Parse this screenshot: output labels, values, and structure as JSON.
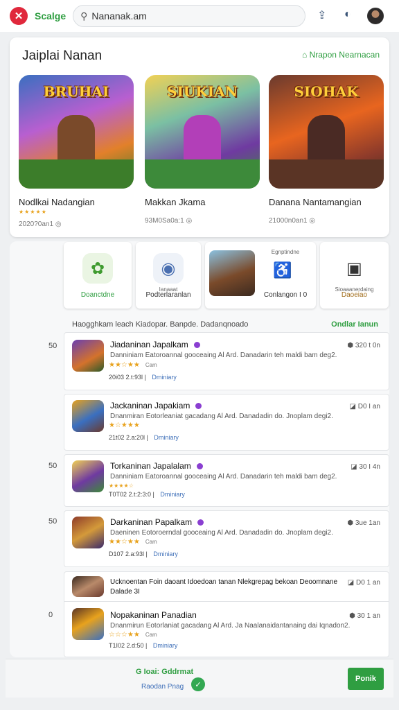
{
  "header": {
    "brand": "Scalge",
    "search_value": "Nananak.am"
  },
  "featured": {
    "title": "Jaiplai Nanan",
    "more_label": "Nrapon Nearnacan",
    "games": [
      {
        "art_title": "BRUHAI",
        "name": "Nodlkai Nadangian",
        "meta": "2020?0an1",
        "colors": [
          "#3a8fd0",
          "#d4722c",
          "#3e7d2c"
        ]
      },
      {
        "art_title": "SIUKIAN",
        "name": "Makkan Jkama",
        "meta": "93M0Sa0a:1",
        "colors": [
          "#f0c247",
          "#9b3fb6",
          "#3d8a3a"
        ]
      },
      {
        "art_title": "SIOHAK",
        "name": "Danana Nantamangian",
        "meta": "21000n0an1",
        "colors": [
          "#e8651f",
          "#8e3b2a",
          "#5a3425"
        ]
      }
    ]
  },
  "categories": [
    {
      "label": "Doanctdne",
      "sub": "",
      "icon": "✿",
      "icon_color": "#3f9b2f",
      "icon_bg": "#eaf5e3"
    },
    {
      "label": "Podterlaranlan",
      "sub": "Ianaaat",
      "icon": "◉",
      "icon_color": "#4a6fb0",
      "icon_bg": "#eef2f8"
    },
    {
      "label": "Conlangon I 0",
      "sub": "Egnptindne",
      "icon": "♿",
      "icon_color": "#333",
      "icon_bg": "#ffffff"
    },
    {
      "label": "Daoeiao",
      "sub": "Sioaaanerdaing",
      "icon": "▣",
      "icon_color": "#333",
      "icon_bg": "#ffffff"
    }
  ],
  "list_header": {
    "left": "Haogghkam leach Kiadopar. Banpde. Dadanqnoado",
    "right": "Ondlar Ianun"
  },
  "side_numbers": [
    "50",
    "50",
    "50",
    "0"
  ],
  "apps": [
    {
      "title": "Jiadaninan Japalkam",
      "desc": "Danniniam Eatoroannal gooceaing Al Ard. Danadarin teh maldi bam deg2.",
      "stars": "★★☆★★",
      "rating": "Cam",
      "date": "20i03 2.t:93l",
      "tag": "Dminiary",
      "size": "320 t 0n"
    },
    {
      "title": "Jackaninan Japakiam",
      "desc": "Dnanmiran Eotorleaniat gacadang Al Ard. Danadadin do. Jnoplam degi2.",
      "stars": "★☆★★★",
      "rating": "",
      "date": "21t02 2.a:20l",
      "tag": "Dminiary",
      "size": "D0 I an"
    },
    {
      "title": "Torkaninan Japalalam",
      "desc": "Danniniam Eatoroannal gooceaing Al Ard. Danadarin teh maldi bam deg2.",
      "stars": "★★★★☆",
      "rating": "",
      "date": "T0T02 2.t:2:3:0",
      "tag": "Dminiary",
      "size": "30 I 4n"
    },
    {
      "title": "Darkaninan Papalkam",
      "desc": "Daeninen Eotoroerndal gooceaing Al Ard. Danadadin do. Jnoplam degi2.",
      "stars": "★★☆★★",
      "rating": "Cam",
      "date": "D107 2.a:93l",
      "tag": "Dminiary",
      "size": "3ue 1an"
    },
    {
      "title": "Ucknoentan Foin daoant Idoedoan tanan Nlekgrepag bekoan Deoomnane Dalade 3I",
      "desc": "",
      "stars": "",
      "rating": "",
      "date": "",
      "tag": "",
      "size": "D0 1 an"
    },
    {
      "title": "Nopakaninan Panadian",
      "desc": "Dnanmirun Eotorlaniat gacadang Al Ard. Ja Naalanaidantanaing dai Iqnadon2.",
      "stars": "☆☆☆★★",
      "rating": "Cam",
      "date": "T1I02 2.d:50",
      "tag": "Dminiary",
      "size": "30 1 an"
    }
  ],
  "bottom": {
    "label": "G Ioai: Gddrmat",
    "sub": "Raodan Pnag",
    "button": "Ponik"
  },
  "colors": {
    "accent_green": "#2f9e41",
    "brand_red": "#e0283c",
    "link_blue": "#3e6fb8",
    "star": "#e8a21d",
    "verified": "#8a3fd1"
  }
}
